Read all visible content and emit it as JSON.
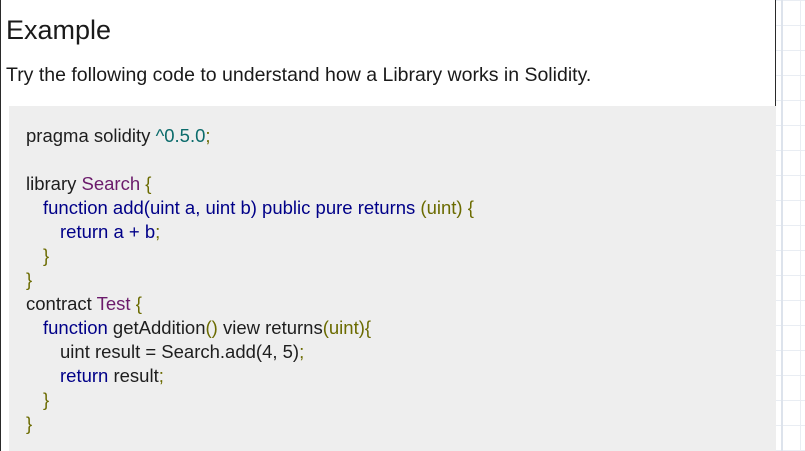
{
  "heading": "Example",
  "intro": "Try the following code to understand how a Library works in Solidity.",
  "code": {
    "l1_a": "pragma solidity ",
    "l1_b": "^0.5.0",
    "l1_c": ";",
    "l3_a": "library ",
    "l3_b": "Search",
    "l3_c": " {",
    "l4_a": "function",
    "l4_b": " add(uint a, uint b) public pure returns ",
    "l4_c": "(uint)",
    "l4_d": " {",
    "l5_a": "return",
    "l5_b": " a + b",
    "l5_c": ";",
    "l6": "}",
    "l7": "}",
    "l8_a": "contract ",
    "l8_b": "Test",
    "l8_c": " {",
    "l9_a": "function",
    "l9_b": " getAddition",
    "l9_c": "()",
    "l9_d": " view returns",
    "l9_e": "(uint){",
    "l10_a": "uint result = Search.add(4, 5)",
    "l10_b": ";",
    "l11_a": "return",
    "l11_b": " result",
    "l11_c": ";",
    "l12": "}",
    "l13": "}"
  }
}
